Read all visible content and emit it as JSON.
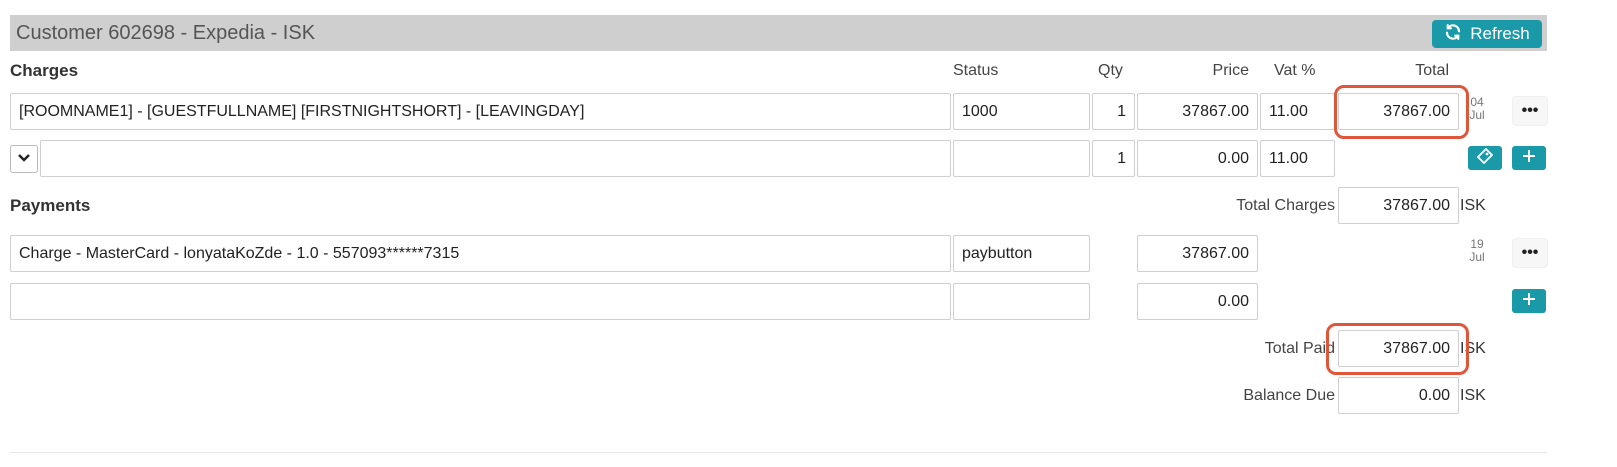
{
  "header": {
    "title": "Customer 602698 - Expedia - ISK",
    "refresh_label": "Refresh",
    "refresh_icon": "refresh-icon"
  },
  "charges": {
    "section_label": "Charges",
    "columns": {
      "status": "Status",
      "qty": "Qty",
      "price": "Price",
      "vat": "Vat %",
      "total": "Total"
    },
    "rows": [
      {
        "description": "[ROOMNAME1] - [GUESTFULLNAME] [FIRSTNIGHTSHORT] - [LEAVINGDAY]",
        "status": "1000",
        "qty": "1",
        "price": "37867.00",
        "vat": "11.00",
        "total": "37867.00",
        "date_day": "04",
        "date_month": "Jul"
      }
    ],
    "new_row": {
      "description": "",
      "status": "",
      "qty": "1",
      "price": "0.00",
      "vat": "11.00"
    }
  },
  "payments": {
    "section_label": "Payments",
    "total_charges_label": "Total Charges",
    "total_charges_value": "37867.00",
    "currency": "ISK",
    "rows": [
      {
        "description": "Charge - MasterCard - lonyataKoZde - 1.0 - 557093******7315",
        "status": "paybutton",
        "amount": "37867.00",
        "date_day": "19",
        "date_month": "Jul"
      }
    ],
    "new_row": {
      "description": "",
      "status": "",
      "amount": "0.00"
    },
    "total_paid_label": "Total Paid",
    "total_paid_value": "37867.00",
    "balance_due_label": "Balance Due",
    "balance_due_value": "0.00"
  },
  "colors": {
    "accent": "#1a9aa8",
    "highlight": "#e0563b",
    "header_bg": "#cfcfcf"
  }
}
